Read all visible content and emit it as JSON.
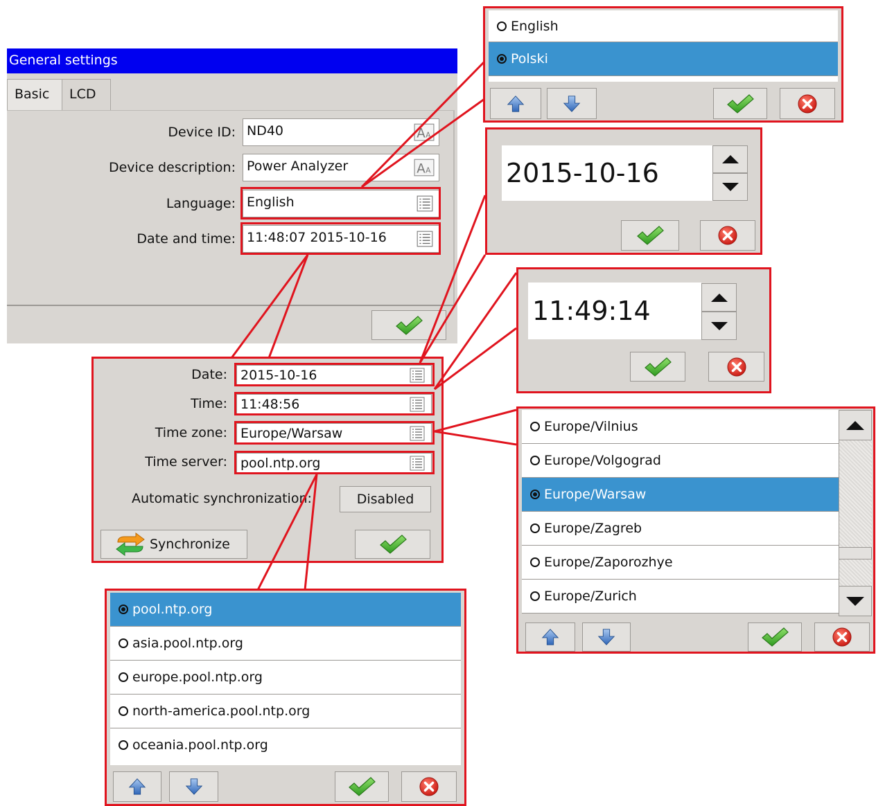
{
  "general": {
    "title": "General settings",
    "tabs": [
      "Basic",
      "LCD"
    ],
    "device_id_label": "Device ID:",
    "device_id_value": "ND40",
    "device_desc_label": "Device description:",
    "device_desc_value": "Power Analyzer",
    "language_label": "Language:",
    "language_value": "English",
    "datetime_label": "Date and time:",
    "datetime_value": "11:48:07 2015-10-16"
  },
  "language_popup": {
    "options": [
      {
        "label": "English",
        "selected": false
      },
      {
        "label": "Polski",
        "selected": true
      }
    ]
  },
  "date_popup": {
    "value": "2015-10-16"
  },
  "time_popup": {
    "value": "11:49:14"
  },
  "datetime_dialog": {
    "date_label": "Date:",
    "date_value": "2015-10-16",
    "time_label": "Time:",
    "time_value": "11:48:56",
    "tz_label": "Time zone:",
    "tz_value": "Europe/Warsaw",
    "server_label": "Time server:",
    "server_value": "pool.ntp.org",
    "autosync_label": "Automatic synchronization:",
    "autosync_value": "Disabled",
    "sync_button": "Synchronize"
  },
  "timezone_popup": {
    "options": [
      {
        "label": "Europe/Vilnius",
        "selected": false
      },
      {
        "label": "Europe/Volgograd",
        "selected": false
      },
      {
        "label": "Europe/Warsaw",
        "selected": true
      },
      {
        "label": "Europe/Zagreb",
        "selected": false
      },
      {
        "label": "Europe/Zaporozhye",
        "selected": false
      },
      {
        "label": "Europe/Zurich",
        "selected": false
      }
    ]
  },
  "server_popup": {
    "options": [
      {
        "label": "pool.ntp.org",
        "selected": true
      },
      {
        "label": "asia.pool.ntp.org",
        "selected": false
      },
      {
        "label": "europe.pool.ntp.org",
        "selected": false
      },
      {
        "label": "north-america.pool.ntp.org",
        "selected": false
      },
      {
        "label": "oceania.pool.ntp.org",
        "selected": false
      }
    ]
  },
  "colors": {
    "title_bar": "#0000f0",
    "selection": "#3a93cf",
    "callout": "#e0141e",
    "panel": "#d9d6d2"
  },
  "icons": [
    "list-icon",
    "font-icon",
    "checkmark-icon",
    "cancel-icon",
    "arrow-up-icon",
    "arrow-down-icon",
    "sync-icon"
  ]
}
